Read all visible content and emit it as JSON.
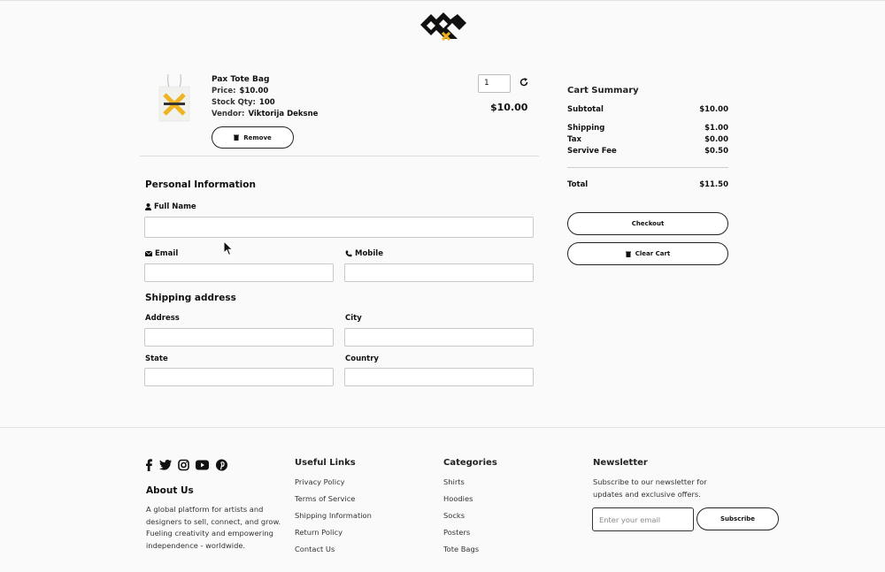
{
  "header": {
    "logo": "logo-mark"
  },
  "cart_item": {
    "name": "Pax Tote Bag",
    "price_label": "Price:",
    "price": "$10.00",
    "stock_label": "Stock Qty:",
    "stock": "100",
    "vendor_label": "Vendor:",
    "vendor": "Viktorija Deksne",
    "remove_label": "Remove",
    "quantity": "1",
    "total": "$10.00"
  },
  "form": {
    "personal_title": "Personal Information",
    "full_name_label": "Full Name",
    "email_label": "Email",
    "mobile_label": "Mobile",
    "shipping_title": "Shipping address",
    "address_label": "Address",
    "city_label": "City",
    "state_label": "State",
    "country_label": "Country"
  },
  "summary": {
    "title": "Cart Summary",
    "subtotal_label": "Subtotal",
    "subtotal": "$10.00",
    "shipping_label": "Shipping",
    "shipping": "$1.00",
    "tax_label": "Tax",
    "tax": "$0.00",
    "service_label": "Servive Fee",
    "service": "$0.50",
    "total_label": "Total",
    "total": "$11.50",
    "checkout_label": "Checkout",
    "clear_label": "Clear Cart"
  },
  "footer": {
    "social_icons": [
      "facebook-icon",
      "twitter-icon",
      "instagram-icon",
      "youtube-icon",
      "pinterest-icon"
    ],
    "about_title": "About Us",
    "about_text": "A global platform for artists and designers to sell, connect, and grow. Fueling creativity and empowering independence - worldwide.",
    "useful_title": "Useful Links",
    "useful_links": [
      "Privacy Policy",
      "Terms of Service",
      "Shipping Information",
      "Return Policy",
      "Contact Us"
    ],
    "categories_title": "Categories",
    "categories": [
      "Shirts",
      "Hoodies",
      "Socks",
      "Posters",
      "Tote Bags"
    ],
    "newsletter_title": "Newsletter",
    "newsletter_text": "Subscribe to our newsletter for updates and exclusive offers.",
    "email_placeholder": "Enter your email",
    "subscribe_label": "Subscribe"
  },
  "colors": {
    "accent": "#f0b323",
    "text": "#111111"
  }
}
